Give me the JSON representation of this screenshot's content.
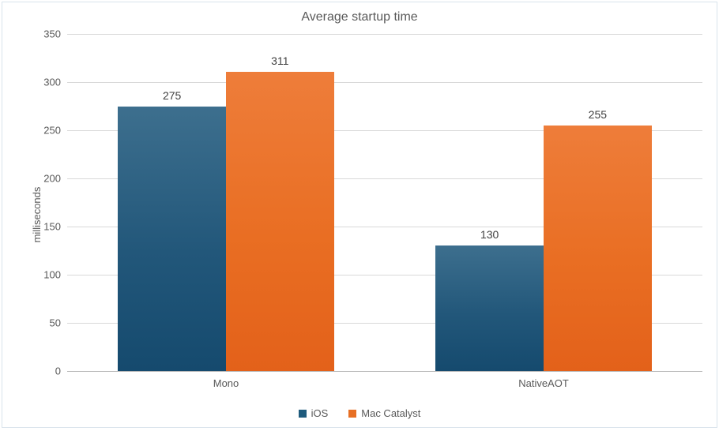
{
  "chart_data": {
    "type": "bar",
    "title": "Average startup time",
    "xlabel": "",
    "ylabel": "milliseconds",
    "ylim": [
      0,
      350
    ],
    "ystep": 50,
    "categories": [
      "Mono",
      "NativeAOT"
    ],
    "series": [
      {
        "name": "iOS",
        "values": [
          275,
          130
        ],
        "color": "#1f5b7d"
      },
      {
        "name": "Mac Catalyst",
        "values": [
          311,
          255
        ],
        "color": "#e76f24"
      }
    ],
    "yticks": [
      "0",
      "50",
      "100",
      "150",
      "200",
      "250",
      "300",
      "350"
    ]
  }
}
